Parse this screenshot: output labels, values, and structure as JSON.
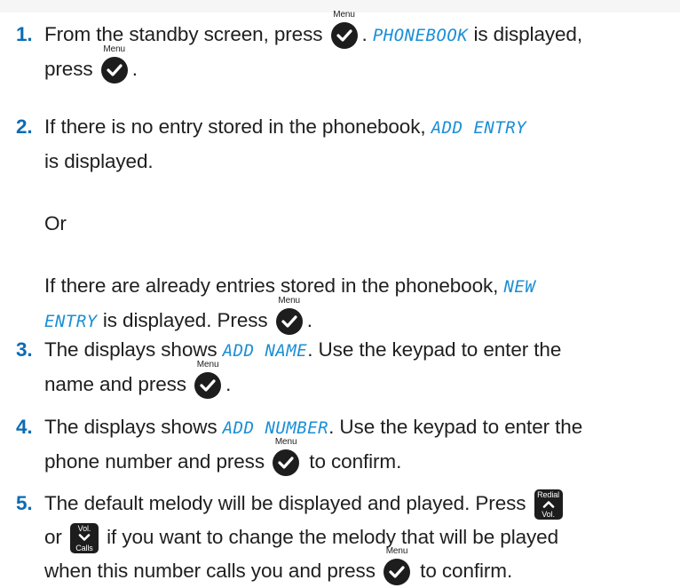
{
  "keys": {
    "menu_label": "Menu",
    "redial_label": "Redial",
    "vol_label": "Vol.",
    "calls_label": "Calls",
    "menu_icon": "check-icon",
    "up_icon": "chevron-up-icon",
    "down_icon": "chevron-down-icon"
  },
  "steps": [
    {
      "number": "1.",
      "t1": "From the standby screen, press",
      "lcd1": "PHONEBOOK",
      "t2": " is displayed,",
      "t3": "press",
      "t4": "."
    },
    {
      "number": "2.",
      "t1": "If there is no entry stored in the phonebook,",
      "lcd1": "ADD ENTRY",
      "t2": "is displayed.",
      "or": "Or",
      "t3": "If there are already entries stored in the phonebook,",
      "lcd2": "NEW",
      "lcd3": "ENTRY",
      "t4": " is displayed. Press",
      "t5": "."
    },
    {
      "number": "3.",
      "t1": "The displays shows",
      "lcd1": "ADD NAME",
      "t2": ". Use the keypad to enter the",
      "t3": "name and press",
      "t4": "."
    },
    {
      "number": "4.",
      "t1": "The displays shows",
      "lcd1": "ADD NUMBER",
      "t2": ". Use the keypad to enter the",
      "t3": "phone number and press",
      "t4": "to confirm."
    },
    {
      "number": "5.",
      "t1": "The default melody will be displayed and played. Press",
      "t2": "or",
      "t3": "if you want to change the melody that will be played",
      "t4": "when this number calls you and press",
      "t5": "to confirm."
    }
  ]
}
